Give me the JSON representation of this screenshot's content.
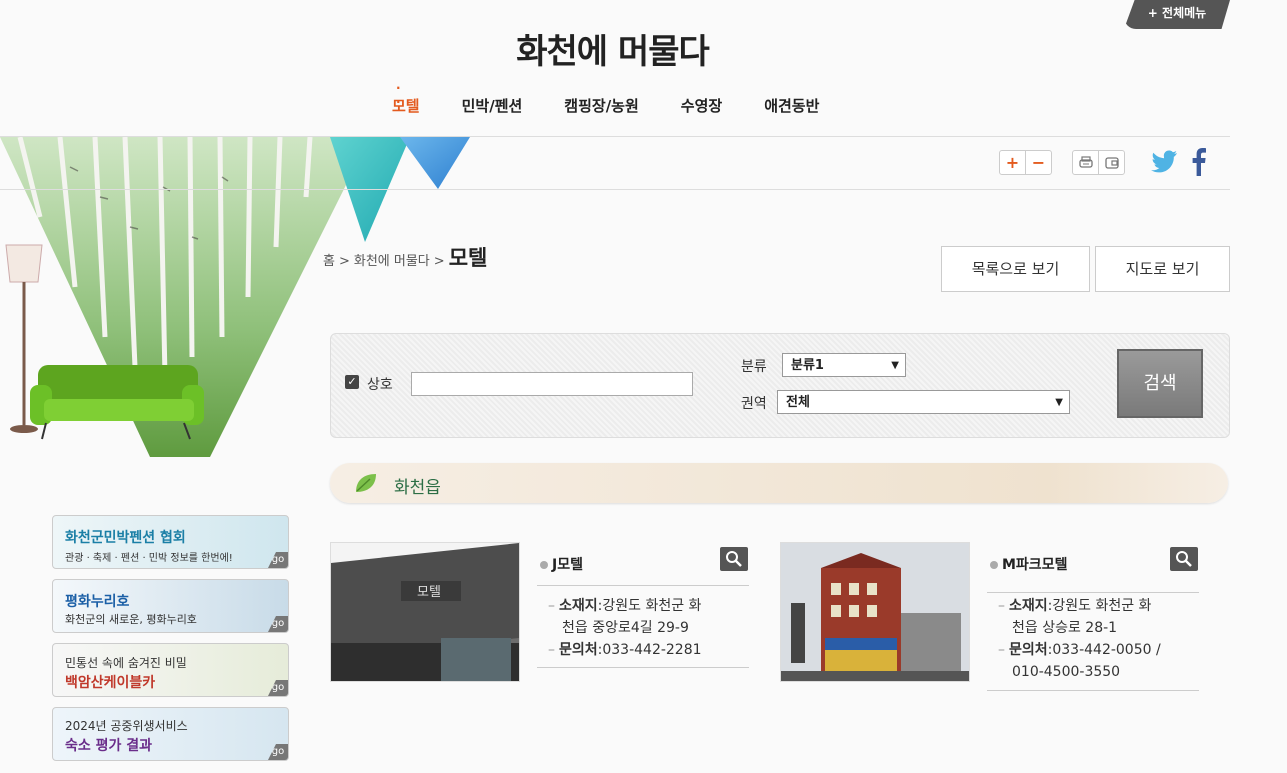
{
  "header": {
    "all_menu": "+ 전체메뉴",
    "site_title": "화천에 머물다",
    "nav": [
      {
        "label": "모텔",
        "active": true
      },
      {
        "label": "민박/펜션"
      },
      {
        "label": "캠핑장/농원"
      },
      {
        "label": "수영장"
      },
      {
        "label": "애견동반"
      }
    ]
  },
  "breadcrumb": {
    "home": "홈",
    "sep": ">",
    "parent": "화천에 머물다",
    "current": "모텔"
  },
  "view_buttons": {
    "list": "목록으로 보기",
    "map": "지도로 보기"
  },
  "search": {
    "checkbox_label": "상호",
    "name_value": "",
    "category_label": "분류",
    "category_value": "분류1",
    "area_label": "권역",
    "area_value": "전체",
    "button": "검색"
  },
  "region": {
    "title": "화천읍"
  },
  "cards": [
    {
      "name": "J모텔",
      "addr_key": "소재지",
      "addr": ":강원도 화천군 화천읍 중앙로4길 29-9",
      "addr_l1": ":강원도 화천군 화",
      "addr_l2": "천읍 중앙로4길 29-9",
      "phone_key": "문의처",
      "phone": ":033-442-2281",
      "sign": "모텔"
    },
    {
      "name": "M파크모텔",
      "addr_key": "소재지",
      "addr_l1": ":강원도 화천군 화",
      "addr_l2": "천읍 상승로 28-1",
      "phone_key": "문의처",
      "phone_l1": ":033-442-0050 /",
      "phone_l2": "010-4500-3550"
    }
  ],
  "banners": [
    {
      "title": "화천군민박펜션 협회",
      "sub": "관광 · 축제 · 펜션 · 민박 정보를 한번에!",
      "go": "go"
    },
    {
      "title": "평화누리호",
      "sub": "화천군의 새로운, 평화누리호",
      "go": "go"
    },
    {
      "title": "민통선 속에 숨겨진 비밀",
      "sub": "백암산케이블카",
      "go": "go"
    },
    {
      "title": "2024년 공중위생서비스",
      "sub": "숙소 평가 결과",
      "go": "go"
    }
  ],
  "colors": {
    "accent": "#e35a1e",
    "region_title": "#2c6e45"
  },
  "icons": [
    "plus-icon",
    "minus-icon",
    "print-icon",
    "bookmark-icon",
    "twitter-icon",
    "facebook-icon",
    "magnifier-icon",
    "leaf-icon",
    "checkbox-icon"
  ]
}
